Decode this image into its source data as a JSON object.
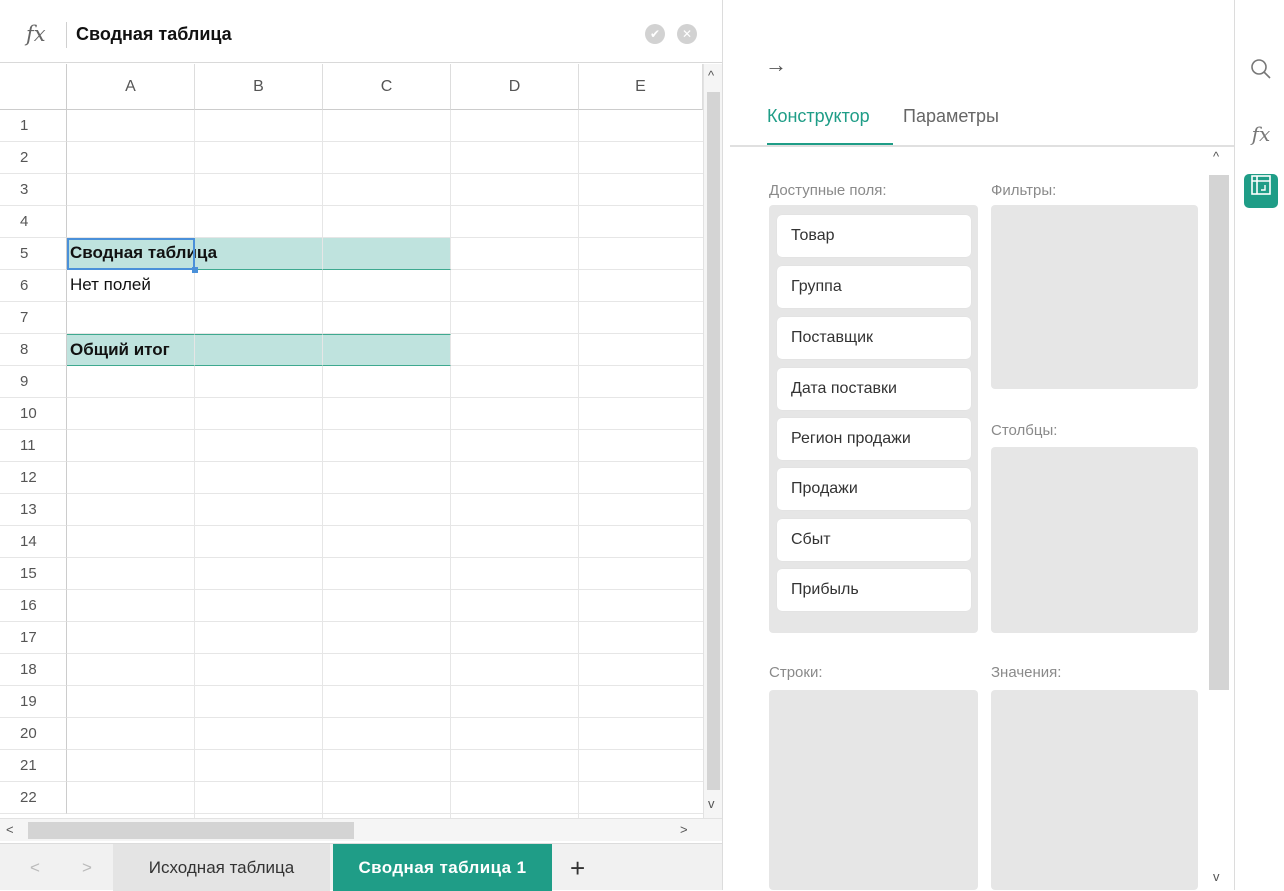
{
  "formula_bar": {
    "fx_label": "fx",
    "content": "Сводная таблица",
    "confirm_icon": "✔",
    "cancel_icon": "✕"
  },
  "columns": [
    "A",
    "B",
    "C",
    "D",
    "E"
  ],
  "rows": [
    "1",
    "2",
    "3",
    "4",
    "5",
    "6",
    "7",
    "8",
    "9",
    "10",
    "11",
    "12",
    "13",
    "14",
    "15",
    "16",
    "17",
    "18",
    "19",
    "20",
    "21",
    "22"
  ],
  "cells": {
    "a5": "Сводная таблица",
    "a6": "Нет полей",
    "a8": "Общий итог"
  },
  "scroll": {
    "up": "^",
    "down": "v",
    "left": "<",
    "right": ">"
  },
  "sheet_tabs": {
    "prev": "<",
    "next": ">",
    "tabs": [
      "Исходная таблица",
      "Сводная таблица 1"
    ],
    "add": "+"
  },
  "pivot_panel": {
    "back_icon": "→",
    "tabs": [
      "Конструктор",
      "Параметры"
    ],
    "available_fields_label": "Доступные поля:",
    "fields": [
      "Товар",
      "Группа",
      "Поставщик",
      "Дата поставки",
      "Регион продажи",
      "Продажи",
      "Сбыт",
      "Прибыль"
    ],
    "filters_label": "Фильтры:",
    "columns_label": "Столбцы:",
    "rows_label": "Строки:",
    "values_label": "Значения:"
  },
  "colors": {
    "accent": "#1f9d87",
    "highlight": "#bfe3de",
    "zone": "#e6e6e6"
  }
}
